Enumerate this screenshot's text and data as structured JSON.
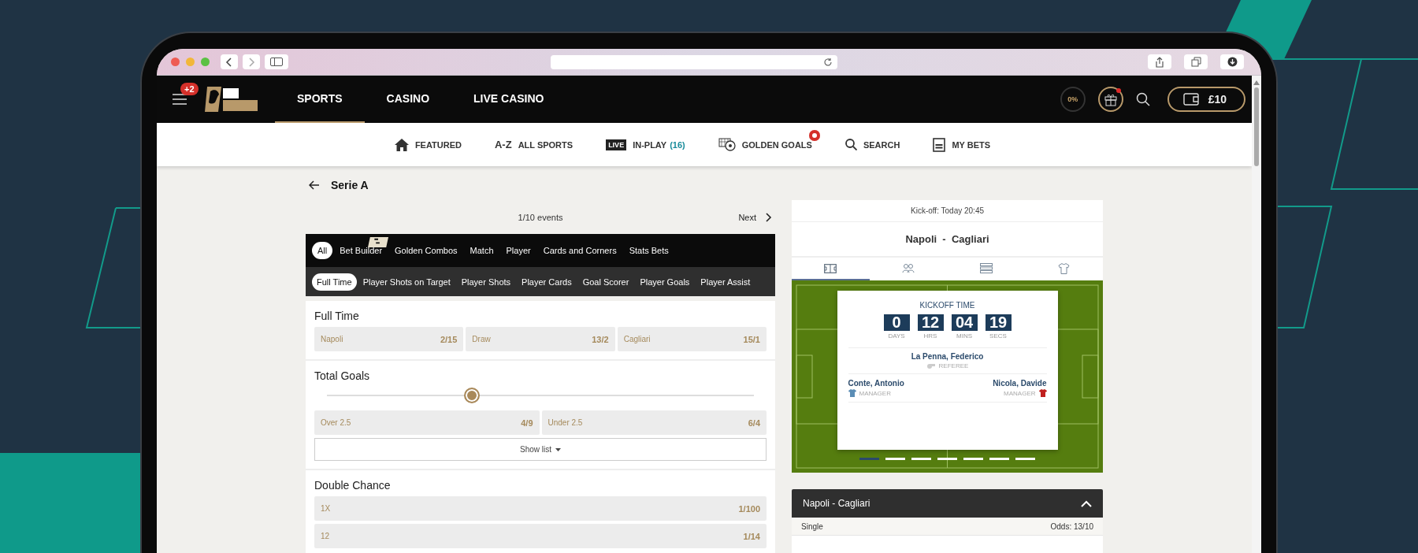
{
  "header": {
    "menu_badge": "+2",
    "tabs": [
      {
        "label": "SPORTS",
        "selected": true
      },
      {
        "label": "CASINO",
        "selected": false
      },
      {
        "label": "LIVE CASINO",
        "selected": false
      }
    ],
    "progress": "0%",
    "gift_notification": true,
    "balance": "£10"
  },
  "subnav": [
    {
      "kind": "home",
      "label": "FEATURED"
    },
    {
      "kind": "az",
      "icon_text": "A-Z",
      "label": "ALL SPORTS"
    },
    {
      "kind": "live",
      "icon_text": "LIVE",
      "label": "IN-PLAY",
      "count": "(16)"
    },
    {
      "kind": "golden",
      "label": "GOLDEN GOALS",
      "badge": true
    },
    {
      "kind": "search",
      "label": "SEARCH"
    },
    {
      "kind": "bets",
      "label": "MY BETS"
    }
  ],
  "page": {
    "title": "Serie A"
  },
  "events_nav": {
    "counter": "1/10 events",
    "next": "Next"
  },
  "market_tabs": [
    {
      "label": "All",
      "selected": true
    },
    {
      "label": "Bet Builder",
      "selected": false,
      "logo": true
    },
    {
      "label": "Golden Combos",
      "selected": false
    },
    {
      "label": "Match",
      "selected": false
    },
    {
      "label": "Player",
      "selected": false
    },
    {
      "label": "Cards and Corners",
      "selected": false
    },
    {
      "label": "Stats Bets",
      "selected": false
    }
  ],
  "sub_tabs": [
    {
      "label": "Full Time",
      "selected": true
    },
    {
      "label": "Player Shots on Target",
      "selected": false
    },
    {
      "label": "Player Shots",
      "selected": false
    },
    {
      "label": "Player Cards",
      "selected": false
    },
    {
      "label": "Goal Scorer",
      "selected": false
    },
    {
      "label": "Player Goals",
      "selected": false
    },
    {
      "label": "Player Assist",
      "selected": false
    }
  ],
  "markets": [
    {
      "kind": "grid",
      "title": "Full Time",
      "selections": [
        {
          "name": "Napoli",
          "odds": "2/15"
        },
        {
          "name": "Draw",
          "odds": "13/2"
        },
        {
          "name": "Cagliari",
          "odds": "15/1"
        }
      ]
    },
    {
      "kind": "slider",
      "title": "Total Goals",
      "level": 0.34,
      "selections": [
        {
          "name": "Over  2.5",
          "odds": "4/9"
        },
        {
          "name": "Under  2.5",
          "odds": "6/4"
        }
      ],
      "show_list": "Show list"
    },
    {
      "kind": "list",
      "title": "Double Chance",
      "selections": [
        {
          "name": "1X",
          "odds": "1/100"
        },
        {
          "name": "12",
          "odds": "1/14"
        }
      ]
    }
  ],
  "match": {
    "kickoff": "Kick-off: Today 20:45",
    "title": "Napoli  -  Cagliari",
    "info_tabs": [
      {
        "kind": "pitch",
        "selected": true
      },
      {
        "kind": "players",
        "selected": false
      },
      {
        "kind": "table",
        "selected": false
      },
      {
        "kind": "shirt",
        "selected": false
      }
    ],
    "countdown": {
      "title": "KICKOFF TIME",
      "units": [
        {
          "value": "0",
          "label": "DAYS"
        },
        {
          "value": "12",
          "label": "HRS"
        },
        {
          "value": "04",
          "label": "MINS"
        },
        {
          "value": "19",
          "label": "SECS"
        }
      ]
    },
    "referee": {
      "name": "La Penna, Federico",
      "role": "REFEREE"
    },
    "managers": [
      {
        "name": "Conte, Antonio",
        "role": "MANAGER",
        "color": "#5b8db5"
      },
      {
        "name": "Nicola, Davide",
        "role": "MANAGER",
        "color": "#c0201e"
      }
    ],
    "carousel": [
      {
        "selected": true
      },
      {
        "selected": false
      },
      {
        "selected": false
      },
      {
        "selected": false
      },
      {
        "selected": false
      },
      {
        "selected": false
      },
      {
        "selected": false
      }
    ]
  },
  "betslip": {
    "title": "Napoli - Cagliari",
    "expanded": true,
    "type": "Single",
    "odds": "Odds: 13/10"
  }
}
